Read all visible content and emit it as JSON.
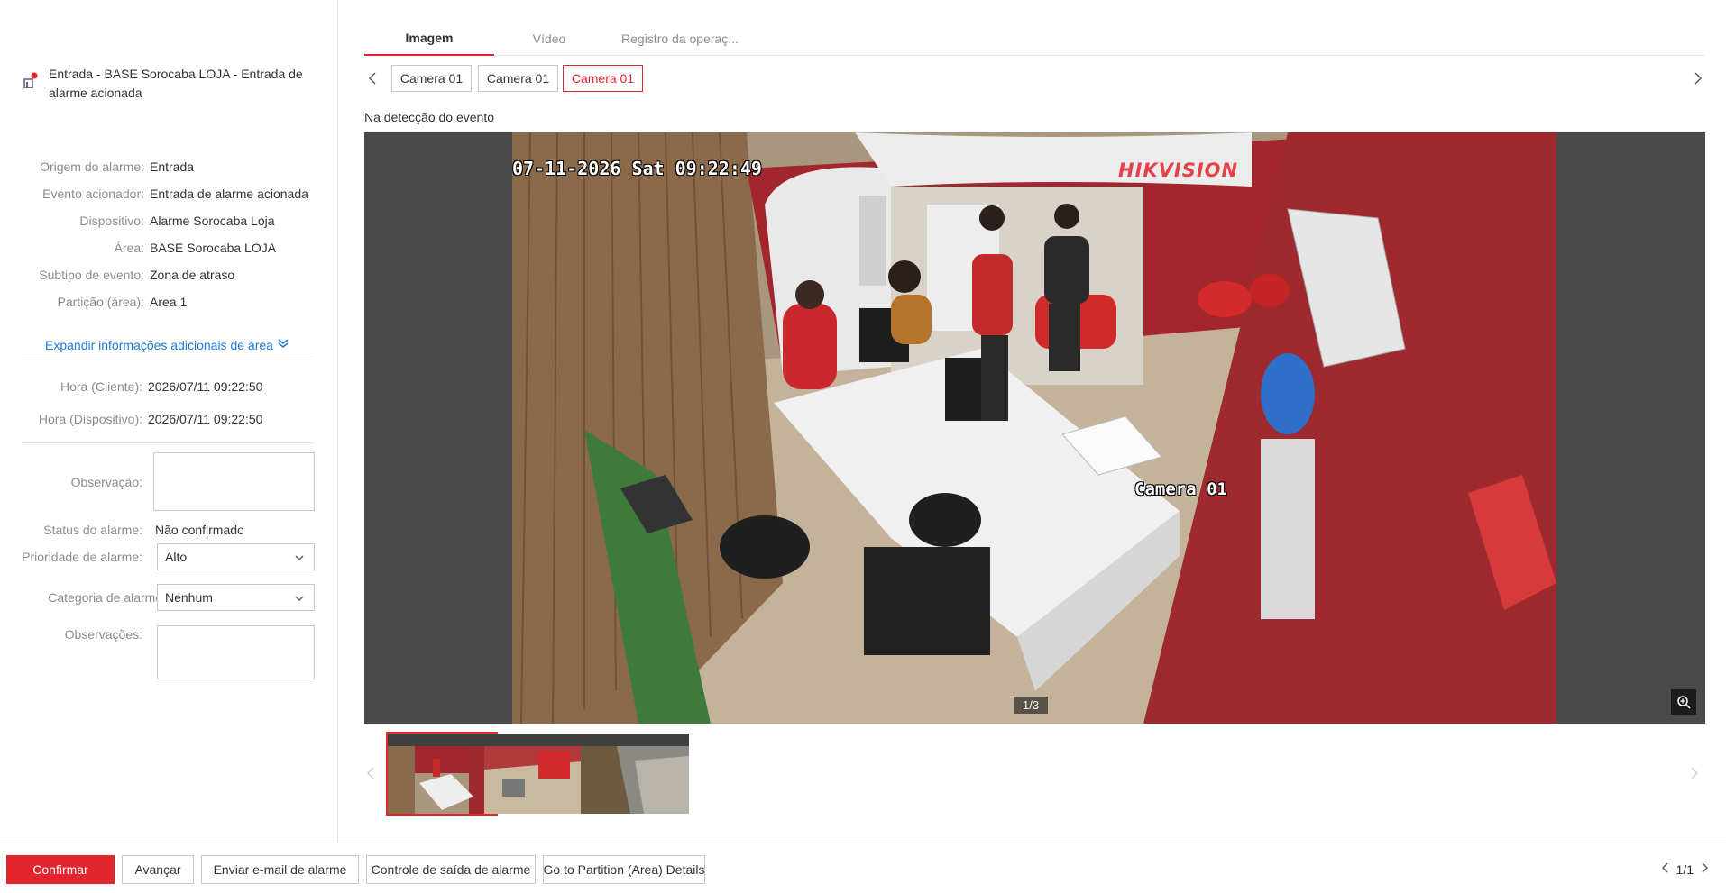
{
  "alarm": {
    "title": "Entrada - BASE Sorocaba LOJA - Entrada de alarme acionada"
  },
  "details": [
    {
      "key": "Origem do alarme:",
      "value": "Entrada"
    },
    {
      "key": "Evento acionador:",
      "value": "Entrada de alarme acionada"
    },
    {
      "key": "Dispositivo:",
      "value": "Alarme Sorocaba Loja"
    },
    {
      "key": "Área:",
      "value": "BASE Sorocaba LOJA"
    },
    {
      "key": "Subtipo de evento:",
      "value": "Zona de atraso"
    },
    {
      "key": "Partição (área):",
      "value": "Area 1"
    }
  ],
  "expand_label": "Expandir informações adicionais de área",
  "times": [
    {
      "key": "Hora (Cliente):",
      "value": "2026/07/11 09:22:50"
    },
    {
      "key": "Hora (Dispositivo):",
      "value": "2026/07/11 09:22:50"
    }
  ],
  "form": {
    "observation_label": "Observação:",
    "observation_value": "",
    "status_label": "Status do alarme:",
    "status_value": "Não confirmado",
    "priority_label": "Prioridade de alarme:",
    "priority_value": "Alto",
    "category_label": "Categoria de alarme:",
    "category_value": "Nenhum",
    "remarks_label": "Observações:",
    "remarks_value": ""
  },
  "tabs": [
    {
      "label": "Imagem",
      "active": true
    },
    {
      "label": "Vídeo",
      "active": false
    },
    {
      "label": "Registro da operaç...",
      "active": false
    }
  ],
  "cameras": [
    {
      "label": "Camera 01",
      "selected": false
    },
    {
      "label": "Camera 01",
      "selected": false
    },
    {
      "label": "Camera 01",
      "selected": true
    }
  ],
  "caption": "Na detecção do evento",
  "image": {
    "timestamp": "07-11-2026 Sat 09:22:49",
    "brand": "HIKVISION",
    "camera_label": "Camera 01",
    "counter": "1/3"
  },
  "bottom": {
    "confirm": "Confirmar",
    "next": "Avançar",
    "email": "Enviar e-mail de alarme",
    "output": "Controle de saída de alarme",
    "partition": "Go to Partition (Area) Details",
    "page": "1/1"
  },
  "colors": {
    "accent": "#e3262e",
    "link": "#1a7ae0"
  }
}
